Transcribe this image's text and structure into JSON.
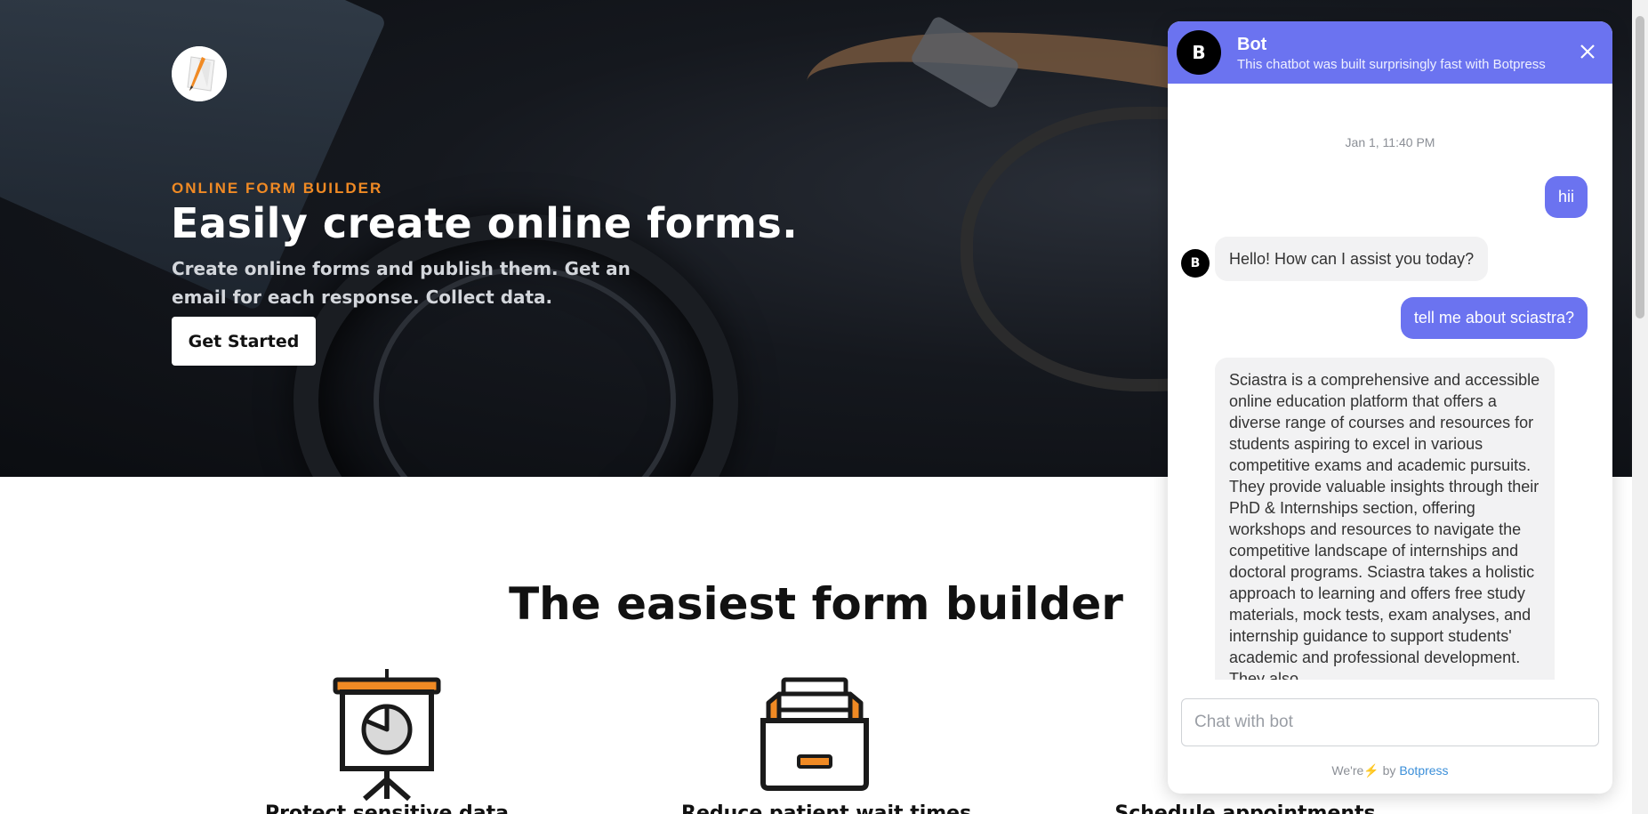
{
  "hero": {
    "eyebrow": "ONLINE FORM BUILDER",
    "title": "Easily create online forms.",
    "subtitle": "Create online forms and publish them. Get an email for each response. Collect data.",
    "cta_label": "Get Started"
  },
  "section": {
    "title": "The easiest form builder",
    "features": [
      {
        "label": "Protect sensitive data",
        "icon": "presentation-chart-icon"
      },
      {
        "label": "Reduce patient wait times",
        "icon": "file-drawer-icon"
      },
      {
        "label": "Schedule appointments",
        "icon": "calendar-icon"
      }
    ]
  },
  "chat": {
    "avatar_letter": "B",
    "bot_name": "Bot",
    "bot_description": "This chatbot was built surprisingly fast with Botpress",
    "timestamp": "Jan 1, 11:40 PM",
    "messages": [
      {
        "from": "user",
        "text": "hii"
      },
      {
        "from": "bot",
        "text": "Hello! How can I assist you today?"
      },
      {
        "from": "user",
        "text": "tell me about sciastra?"
      },
      {
        "from": "bot",
        "text": "Sciastra is a comprehensive and accessible online education platform that offers a diverse range of courses and resources for students aspiring to excel in various competitive exams and academic pursuits. They provide valuable insights through their PhD & Internships section, offering workshops and resources to navigate the competitive landscape of internships and doctoral programs. Sciastra takes a holistic approach to learning and offers free study materials, mock tests, exam analyses, and internship guidance to support students' academic and professional development. They also"
      }
    ],
    "input_placeholder": "Chat with bot",
    "powered_prefix": "We're",
    "powered_by": "by",
    "powered_brand": "Botpress"
  },
  "colors": {
    "accent": "#6b73f0",
    "orange": "#f08a24",
    "bubble_bot": "#f2f2f3"
  }
}
